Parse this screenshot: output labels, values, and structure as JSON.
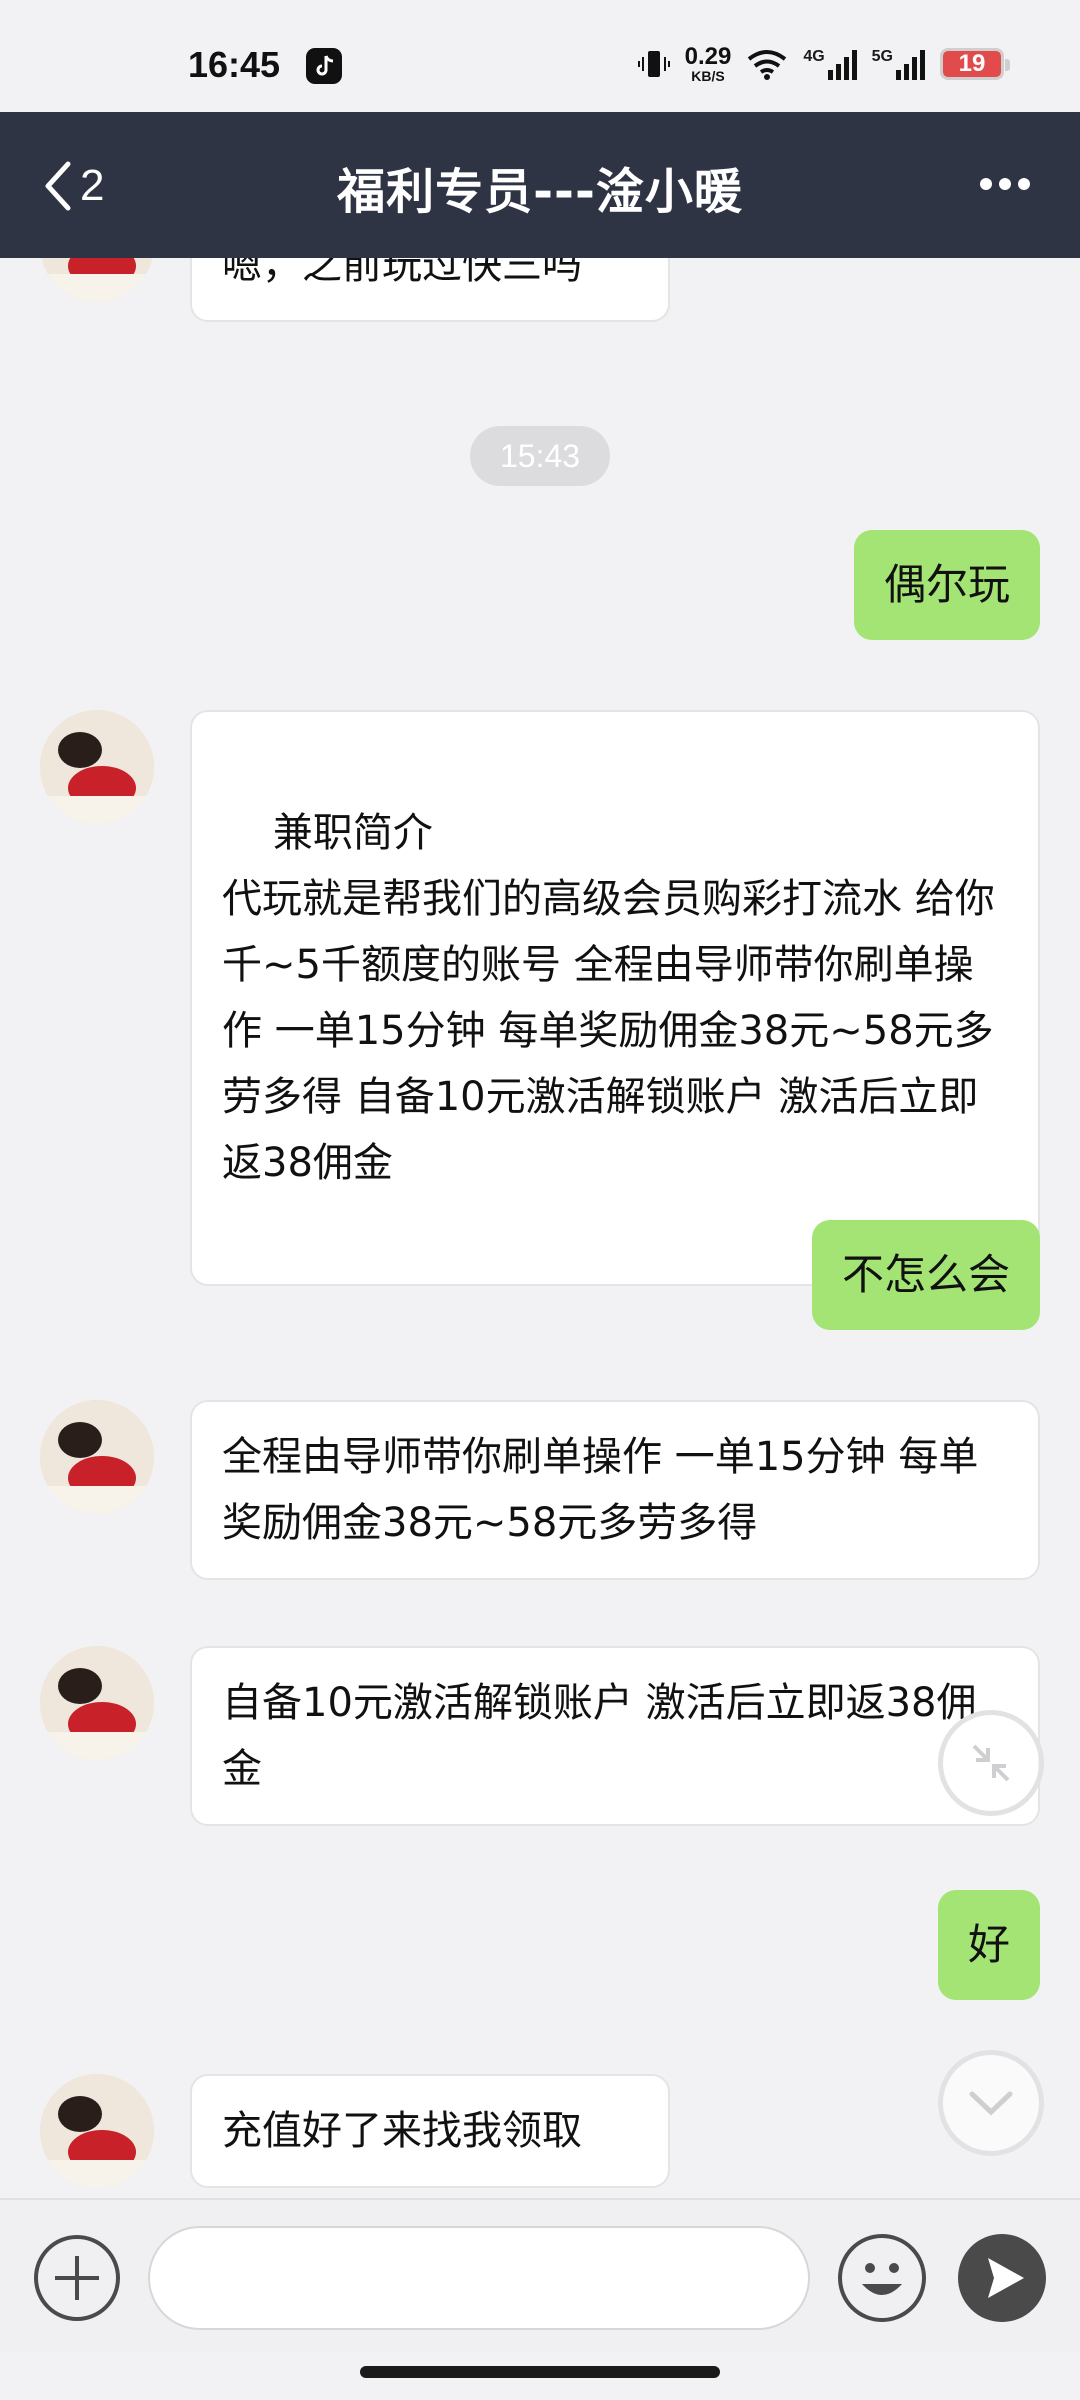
{
  "status_bar": {
    "time": "16:45",
    "net_speed_value": "0.29",
    "net_speed_unit": "KB/S",
    "net_4g": "4G",
    "net_5g": "5G",
    "battery": "19"
  },
  "header": {
    "back_count": "2",
    "title": "福利专员---淦小暖"
  },
  "messages": [
    {
      "side": "in",
      "text": "嗯，之前玩过快三吗"
    },
    {
      "side": "time",
      "text": "15:43"
    },
    {
      "side": "out",
      "text": "偶尔玩"
    },
    {
      "side": "in",
      "text": "兼职简介\n代玩就是帮我们的高级会员购彩打流水 给你千~5千额度的账号 全程由导师带你刷单操作 一单15分钟 每单奖励佣金38元~58元多劳多得 自备10元激活解锁账户 激活后立即返38佣金"
    },
    {
      "side": "out",
      "text": "不怎么会"
    },
    {
      "side": "in",
      "text": "全程由导师带你刷单操作 一单15分钟 每单奖励佣金38元~58元多劳多得"
    },
    {
      "side": "in",
      "text": "自备10元激活解锁账户 激活后立即返38佣金"
    },
    {
      "side": "out",
      "text": "好"
    },
    {
      "side": "in",
      "text": "充值好了来找我领取"
    }
  ],
  "input": {
    "value": "",
    "placeholder": ""
  },
  "icons": {
    "back": "chevron-left-icon",
    "more": "more-dots-icon",
    "add": "plus-circle-icon",
    "emoji": "smiley-icon",
    "send": "send-icon",
    "collapse": "collapse-arrows-icon",
    "scroll_down": "chevron-down-icon"
  },
  "colors": {
    "header_bg": "#2e3443",
    "outgoing_bubble": "#a3e474",
    "incoming_bubble": "#ffffff",
    "battery_low": "#e24b4b"
  }
}
